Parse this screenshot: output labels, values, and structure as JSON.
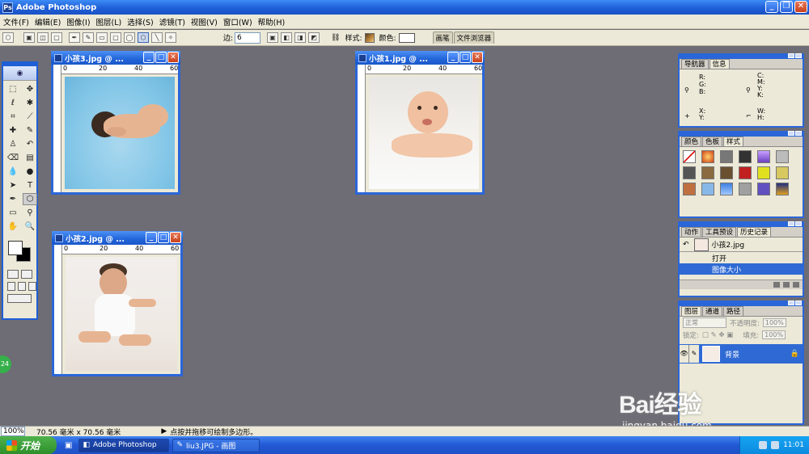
{
  "app": {
    "title": "Adobe Photoshop"
  },
  "menu": [
    "文件(F)",
    "编辑(E)",
    "图像(I)",
    "图层(L)",
    "选择(S)",
    "滤镜(T)",
    "视图(V)",
    "窗口(W)",
    "帮助(H)"
  ],
  "options": {
    "sides_label": "边:",
    "sides_value": "6",
    "style_label": "样式:",
    "color_label": "颜色:",
    "well_tabs": [
      "画笔",
      "文件浏览器"
    ]
  },
  "documents": [
    {
      "title": "小孩3.jpg @ ...",
      "ruler": [
        "0",
        "20",
        "40",
        "60"
      ]
    },
    {
      "title": "小孩1.jpg @ ...",
      "ruler": [
        "0",
        "20",
        "40",
        "60"
      ]
    },
    {
      "title": "小孩2.jpg @ ...",
      "ruler": [
        "0",
        "20",
        "40",
        "60"
      ]
    }
  ],
  "panels": {
    "navigator": {
      "tabs": [
        "导航器",
        "信息"
      ],
      "labels": [
        "R:",
        "G:",
        "B:",
        "C:",
        "M:",
        "Y:",
        "K:",
        "X:",
        "Y:",
        "W:",
        "H:"
      ]
    },
    "color": {
      "tabs": [
        "颜色",
        "色板",
        "样式"
      ]
    },
    "history": {
      "tabs": [
        "动作",
        "工具预设",
        "历史记录"
      ],
      "source": "小孩2.jpg",
      "items": [
        "打开",
        "图像大小"
      ]
    },
    "layers": {
      "tabs": [
        "图层",
        "通道",
        "路径"
      ],
      "blend": "正常",
      "opacity_label": "不透明度:",
      "opacity": "100%",
      "lock_label": "锁定:",
      "fill_label": "填充:",
      "fill": "100%",
      "layer_name": "背景"
    }
  },
  "status": {
    "zoom": "100%",
    "size": "70.56 毫米 x 70.56 毫米",
    "hint": "点按并拖移可绘制多边形。"
  },
  "taskbar": {
    "start": "开始",
    "tasks": [
      "Adobe Photoshop",
      "liu3.JPG - 画图"
    ],
    "clock": "11:01"
  },
  "badge": "24",
  "watermark": {
    "brand": "Bai经验",
    "url": "jingyan.baidu.com"
  }
}
